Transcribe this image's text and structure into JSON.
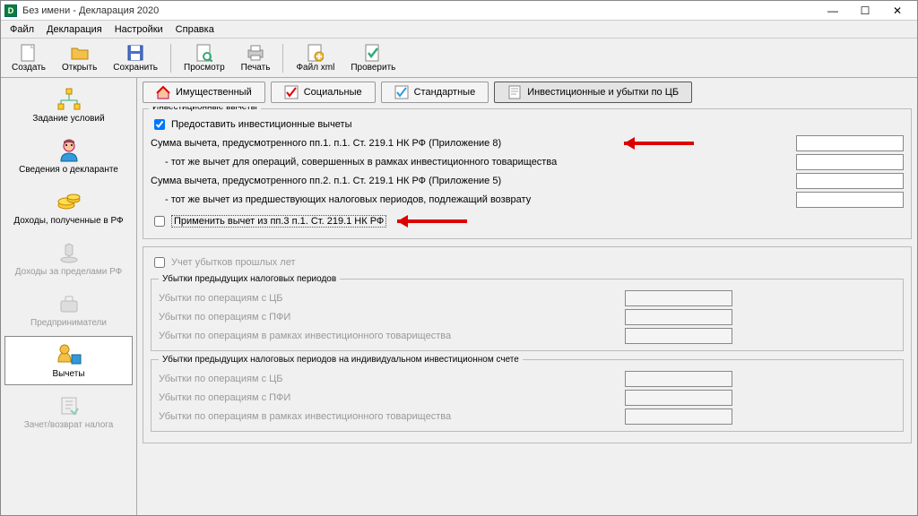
{
  "window": {
    "title": "Без имени - Декларация 2020"
  },
  "menu": {
    "file": "Файл",
    "declaration": "Декларация",
    "settings": "Настройки",
    "help": "Справка"
  },
  "toolbar": {
    "create": "Создать",
    "open": "Открыть",
    "save": "Сохранить",
    "preview": "Просмотр",
    "print": "Печать",
    "xml": "Файл xml",
    "check": "Проверить"
  },
  "sidebar": {
    "items": [
      {
        "label": "Задание условий",
        "disabled": false
      },
      {
        "label": "Сведения о декларанте",
        "disabled": false
      },
      {
        "label": "Доходы, полученные в РФ",
        "disabled": false
      },
      {
        "label": "Доходы за пределами РФ",
        "disabled": true
      },
      {
        "label": "Предприниматели",
        "disabled": true
      },
      {
        "label": "Вычеты",
        "disabled": false,
        "active": true
      },
      {
        "label": "Зачет/возврат налога",
        "disabled": true
      }
    ]
  },
  "tabs": {
    "property": "Имущественный",
    "social": "Социальные",
    "standard": "Стандартные",
    "investment": "Инвестиционные и убытки по ЦБ"
  },
  "invest": {
    "group_title": "Инвестиционные вычеты",
    "provide_chk": "Предоставить инвестиционные вычеты",
    "row1": "Сумма вычета, предусмотренного пп.1. п.1. Ст. 219.1 НК РФ (Приложение 8)",
    "row1a": "- тот же вычет для операций, совершенных в рамках инвестиционного товарищества",
    "row2": "Сумма вычета, предусмотренного пп.2. п.1. Ст. 219.1 НК РФ (Приложение 5)",
    "row2a": "- тот же вычет из предшествующих налоговых периодов, подлежащий возврату",
    "apply_chk": "Применить вычет из пп.3 п.1. Ст. 219.1 НК РФ",
    "values": {
      "v1": "",
      "v1a": "",
      "v2": "",
      "v2a": ""
    }
  },
  "losses": {
    "account_chk": "Учет убытков прошлых лет",
    "prev_periods_title": "Убытки предыдущих налоговых периодов",
    "iis_title": "Убытки предыдущих налоговых периодов на индивидуальном инвестиционном счете",
    "row_cb": "Убытки по операциям с ЦБ",
    "row_pfi": "Убытки по операциям с ПФИ",
    "row_it": "Убытки по операциям в рамках инвестиционного товарищества",
    "values": {
      "cb1": "",
      "pfi1": "",
      "it1": "",
      "cb2": "",
      "pfi2": "",
      "it2": ""
    }
  }
}
